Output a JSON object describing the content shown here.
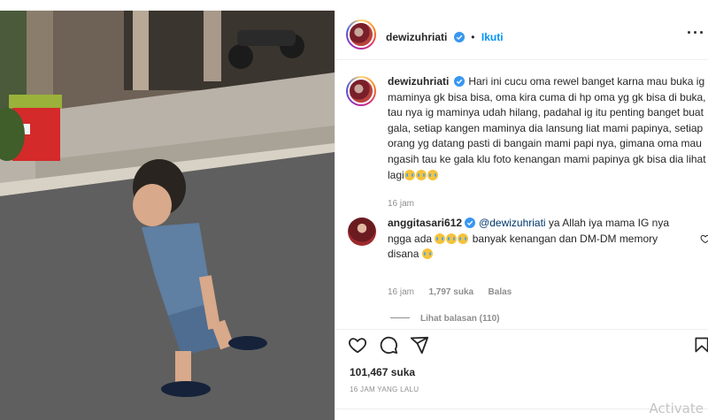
{
  "post": {
    "author": "dewizuhriati",
    "follow_label": "Ikuti",
    "separator": "•",
    "more_label": "···"
  },
  "caption": {
    "author": "dewizuhriati",
    "text": "Hari ini cucu oma rewel banget karna mau buka ig maminya gk bisa bisa, oma kira cuma di hp oma yg gk bisa di buka, tau nya ig maminya udah hilang, padahal ig itu penting banget buat gala, setiap kangen maminya dia lansung liat mami papinya, setiap orang yg datang pasti di bangain mami papi nya, gimana oma mau ngasih tau ke gala klu foto kenangan mami papinya gk bisa dia lihat lagi",
    "time": "16 jam",
    "emoji": "crying-face-emoji"
  },
  "comment": {
    "author": "anggitasari612",
    "mention": "@dewizuhriati",
    "text_part1": " ya Allah iya mama IG nya ngga ada ",
    "text_part2": " banyak kenangan dan DM-DM memory disana ",
    "time": "16 jam",
    "likes": "1,797 suka",
    "reply_label": "Balas",
    "view_replies": "Lihat balasan (110)"
  },
  "actions": {
    "like_icon": "heart-icon",
    "comment_icon": "comment-icon",
    "share_icon": "share-icon",
    "save_icon": "bookmark-icon"
  },
  "likes_count": "101,467 suka",
  "post_date": "16 JAM YANG LALU",
  "watermark": "Activate",
  "colors": {
    "link": "#0095f6",
    "mention": "#00376b",
    "muted": "#8e8e8e",
    "verified": "#3897f0"
  }
}
